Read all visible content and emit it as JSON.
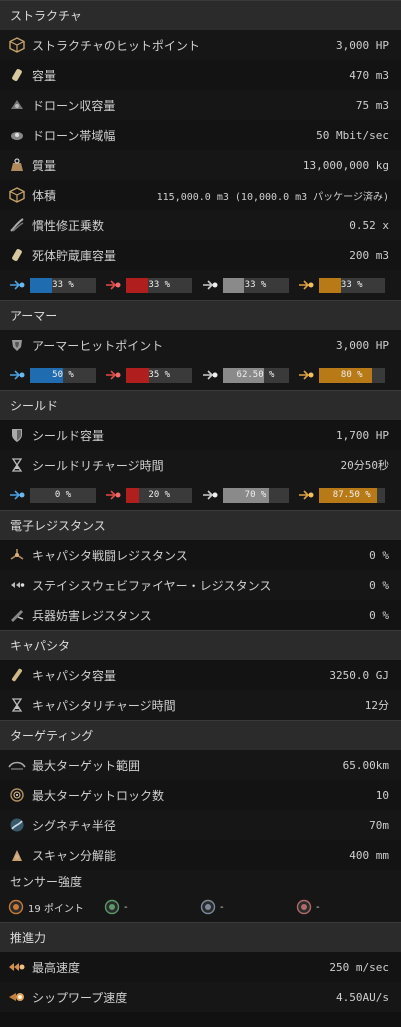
{
  "colors": {
    "em": "#1f6db0",
    "thermal": "#b01e1e",
    "kinetic": "#8a8a8a",
    "explosive": "#b87a16"
  },
  "structure": {
    "header": "ストラクチャ",
    "rows": [
      {
        "icon": "cube-icon",
        "label": "ストラクチャのヒットポイント",
        "value": "3,000 HP"
      },
      {
        "icon": "canister-icon",
        "label": "容量",
        "value": "470 m3"
      },
      {
        "icon": "drone-bay-icon",
        "label": "ドローン収容量",
        "value": "75 m3"
      },
      {
        "icon": "drone-bandwidth-icon",
        "label": "ドローン帯域幅",
        "value": "50 Mbit/sec"
      },
      {
        "icon": "mass-icon",
        "label": "質量",
        "value": "13,000,000 kg"
      },
      {
        "icon": "volume-icon",
        "label": "体積",
        "value": "115,000.0 m3 (10,000.0 m3 パッケージ済み)"
      },
      {
        "icon": "inertia-icon",
        "label": "慣性修正乗数",
        "value": "0.52 x"
      },
      {
        "icon": "corpse-bay-icon",
        "label": "死体貯蔵庫容量",
        "value": "200 m3"
      }
    ],
    "resist": [
      {
        "v": 0.33,
        "label": "33 %"
      },
      {
        "v": 0.33,
        "label": "33 %"
      },
      {
        "v": 0.33,
        "label": "33 %"
      },
      {
        "v": 0.33,
        "label": "33 %"
      }
    ]
  },
  "armor": {
    "header": "アーマー",
    "rows": [
      {
        "icon": "armor-hp-icon",
        "label": "アーマーヒットポイント",
        "value": "3,000 HP"
      }
    ],
    "resist": [
      {
        "v": 0.5,
        "label": "50 %"
      },
      {
        "v": 0.35,
        "label": "35 %"
      },
      {
        "v": 0.625,
        "label": "62.50 %"
      },
      {
        "v": 0.8,
        "label": "80 %"
      }
    ]
  },
  "shield": {
    "header": "シールド",
    "rows": [
      {
        "icon": "shield-icon",
        "label": "シールド容量",
        "value": "1,700 HP"
      },
      {
        "icon": "hourglass-icon",
        "label": "シールドリチャージ時間",
        "value": "20分50秒"
      }
    ],
    "resist": [
      {
        "v": 0.0,
        "label": "0 %"
      },
      {
        "v": 0.2,
        "label": "20 %"
      },
      {
        "v": 0.7,
        "label": "70 %"
      },
      {
        "v": 0.875,
        "label": "87.50 %"
      }
    ]
  },
  "electronic": {
    "header": "電子レジスタンス",
    "rows": [
      {
        "icon": "capacitor-warfare-icon",
        "label": "キャパシタ戦闘レジスタンス",
        "value": "0 %"
      },
      {
        "icon": "stasis-web-icon",
        "label": "ステイシスウェビファイヤー・レジスタンス",
        "value": "0 %"
      },
      {
        "icon": "weapon-disruption-icon",
        "label": "兵器妨害レジスタンス",
        "value": "0 %"
      }
    ]
  },
  "capacitor": {
    "header": "キャパシタ",
    "rows": [
      {
        "icon": "capacitor-icon",
        "label": "キャパシタ容量",
        "value": "3250.0 GJ"
      },
      {
        "icon": "hourglass-icon",
        "label": "キャパシタリチャージ時間",
        "value": "12分"
      }
    ]
  },
  "targeting": {
    "header": "ターゲティング",
    "rows": [
      {
        "icon": "target-range-icon",
        "label": "最大ターゲット範囲",
        "value": "65.00km"
      },
      {
        "icon": "target-lock-icon",
        "label": "最大ターゲットロック数",
        "value": "10"
      },
      {
        "icon": "signature-icon",
        "label": "シグネチャ半径",
        "value": "70m"
      },
      {
        "icon": "scan-resolution-icon",
        "label": "スキャン分解能",
        "value": "400 mm"
      }
    ],
    "sensor_label": "センサー強度",
    "sensors": [
      {
        "icon": "radar-sensor-icon",
        "value": "19 ポイント",
        "color": "#c47a3a"
      },
      {
        "icon": "ladar-sensor-icon",
        "value": "-",
        "color": "#5a9a6a"
      },
      {
        "icon": "magnetometric-sensor-icon",
        "value": "-",
        "color": "#7a8a9a"
      },
      {
        "icon": "gravimetric-sensor-icon",
        "value": "-",
        "color": "#b06a6a"
      }
    ]
  },
  "propulsion": {
    "header": "推進力",
    "rows": [
      {
        "icon": "max-velocity-icon",
        "label": "最高速度",
        "value": "250 m/sec"
      },
      {
        "icon": "warp-speed-icon",
        "label": "シップワープ速度",
        "value": "4.50AU/s"
      }
    ]
  }
}
